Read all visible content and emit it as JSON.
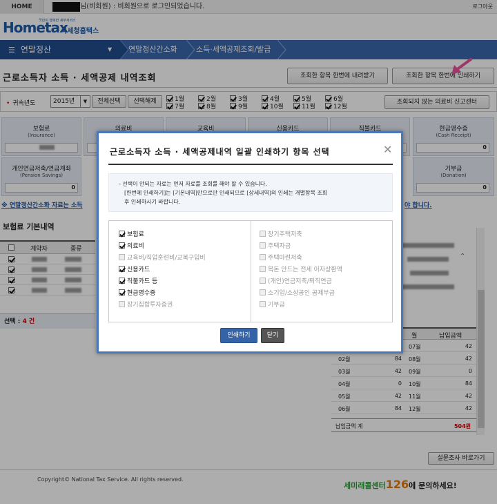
{
  "topbar": {
    "home": "HOME",
    "login_msg": "님(비회원) : 비회원으로 로그인되었습니다.",
    "logout": "로그아웃"
  },
  "logo": {
    "main": "Hometax",
    "sub": "국세청홈택스",
    "tag": "국민이 행복한 세무서비스"
  },
  "nav": {
    "menu": "연말정산",
    "crumbs": [
      "연말정산간소화",
      "소득·세액공제조회/발급"
    ]
  },
  "page": {
    "title": "근로소득자 소득 · 세액공제 내역조회",
    "download_all": "조회한 항목 한번에 내려받기",
    "print_all": "조회한 항목 한번에 인쇄하기"
  },
  "filter": {
    "year_label": "귀속년도",
    "year_value": "2015년",
    "select_all": "전체선택",
    "deselect_all": "선택해제",
    "months": [
      "1월",
      "2월",
      "3월",
      "4월",
      "5월",
      "6월",
      "7월",
      "8월",
      "9월",
      "10월",
      "11월",
      "12월"
    ],
    "report_center": "조회되지 않는 의료비 신고센터"
  },
  "cards": [
    {
      "title": "보험료",
      "sub": "(Insurance)"
    },
    {
      "title": "의료비",
      "sub": ""
    },
    {
      "title": "교육비",
      "sub": ""
    },
    {
      "title": "신용카드",
      "sub": ""
    },
    {
      "title": "직불카드",
      "sub": ""
    },
    {
      "title": "현금영수증",
      "sub": "(Cash Receipt)",
      "value": "0"
    },
    {
      "title": "개인연금저축/연금계좌",
      "sub": "(Pension Savings)",
      "value": "0"
    },
    {
      "title": "기부금",
      "sub": "(Donation)",
      "value": "0"
    }
  ],
  "notice": {
    "text": "※ 연말정산간소화 자료는 소득",
    "tail": "야 합니다."
  },
  "insurance": {
    "title": "보험료 기본내역",
    "headers": [
      "계약자",
      "종류"
    ],
    "selected_label": "선택 :",
    "selected_count": "4 건"
  },
  "payments": {
    "header_right_month": "월",
    "header_amount": "납입금액",
    "rows": [
      {
        "m1": "",
        "a1": "",
        "m2": "07월",
        "a2": "42"
      },
      {
        "m1": "02월",
        "a1": "84",
        "m2": "08월",
        "a2": "42"
      },
      {
        "m1": "03월",
        "a1": "42",
        "m2": "09월",
        "a2": "0"
      },
      {
        "m1": "04월",
        "a1": "0",
        "m2": "10월",
        "a2": "84"
      },
      {
        "m1": "05월",
        "a1": "42",
        "m2": "11월",
        "a2": "42"
      },
      {
        "m1": "06월",
        "a1": "84",
        "m2": "12월",
        "a2": "42"
      }
    ],
    "total_label": "납입금액 계",
    "total_value": "504원"
  },
  "survey": "설문조사 바로가기",
  "footer": {
    "copyright": "Copyright© National Tax Service. All rights reserved.",
    "call_a": "세미래콜센터",
    "call_n": "126",
    "call_b": "에 문의하세요!"
  },
  "modal": {
    "title": "근로소득자 소득 · 세액공제내역 일괄 인쇄하기 항목 선택",
    "info": [
      "- 선택이 안되는 자료는 먼저 자료를 조회를 해야 할 수 있습니다.",
      "[한번에 인쇄하기]는 [기본내역]만으로만 인쇄되므로 [상세내역]의 인쇄는 개별항목 조회",
      "후 인쇄하시기 바랍니다."
    ],
    "left_options": [
      {
        "label": "보험료",
        "checked": true,
        "disabled": false
      },
      {
        "label": "의료비",
        "checked": true,
        "disabled": false
      },
      {
        "label": "교육비/직업훈련비/교복구입비",
        "checked": false,
        "disabled": true
      },
      {
        "label": "신용카드",
        "checked": true,
        "disabled": false
      },
      {
        "label": "직불카드 등",
        "checked": true,
        "disabled": false
      },
      {
        "label": "현금영수증",
        "checked": true,
        "disabled": false
      },
      {
        "label": "장기집합투자증권",
        "checked": false,
        "disabled": true
      }
    ],
    "right_options": [
      {
        "label": "장기주택저축",
        "checked": false,
        "disabled": true
      },
      {
        "label": "주택자금",
        "checked": false,
        "disabled": true
      },
      {
        "label": "주택마련저축",
        "checked": false,
        "disabled": true
      },
      {
        "label": "목돈 안드는 전세 이자상환액",
        "checked": false,
        "disabled": true
      },
      {
        "label": "(개인)연금저축/퇴직연금",
        "checked": false,
        "disabled": true
      },
      {
        "label": "소기업/소상공인 공제부금",
        "checked": false,
        "disabled": true
      },
      {
        "label": "기부금",
        "checked": false,
        "disabled": true
      }
    ],
    "print_label": "인쇄하기",
    "close_label": "닫기"
  },
  "colors": {
    "nav": "#3a68ad",
    "nav_dark": "#234d8f",
    "modal_border": "#4a78b8",
    "primary_button": "#3463a8",
    "accent_red": "#cc0000"
  }
}
